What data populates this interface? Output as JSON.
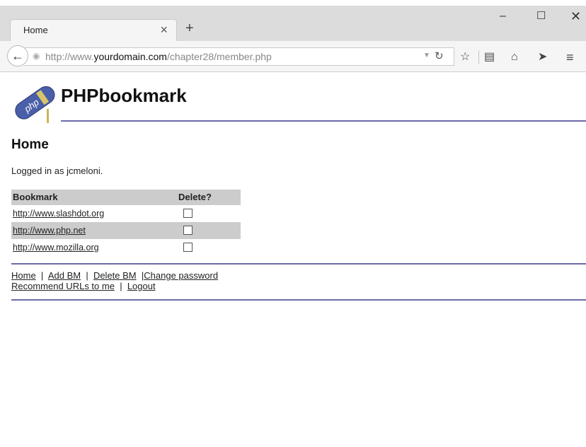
{
  "browser": {
    "tab_title": "Home",
    "tab_close": "×",
    "new_tab": "+",
    "window_controls": {
      "minimize": "–",
      "maximize": "☐",
      "close": "✕"
    },
    "url_prefix": "http://www.",
    "url_host": "yourdomain.com",
    "url_path": "/chapter28/member.php",
    "icons": [
      "back-arrow-icon",
      "globe-icon",
      "dropdown-icon",
      "reload-icon",
      "star-icon",
      "reader-icon",
      "home-icon",
      "send-icon",
      "menu-icon"
    ]
  },
  "page": {
    "logo_text": "php",
    "site_title": "PHPbookmark",
    "heading": "Home",
    "logged_in": "Logged in as jcmeloni.",
    "table": {
      "headers": {
        "bookmark": "Bookmark",
        "delete": "Delete?"
      },
      "rows": [
        {
          "url": "http://www.slashdot.org",
          "checked": false
        },
        {
          "url": "http://www.php.net",
          "checked": false
        },
        {
          "url": "http://www.mozilla.org",
          "checked": false
        }
      ]
    },
    "menu": {
      "home": "Home",
      "add_bm": "Add BM",
      "delete_bm": "Delete BM",
      "change_password": "Change password",
      "recommend": "Recommend URLs to me",
      "logout": "Logout",
      "separator": "|"
    }
  },
  "colors": {
    "rule": "#6c6aa7",
    "table_shade": "#cccccc",
    "logo_blue": "#4a5fa8"
  }
}
